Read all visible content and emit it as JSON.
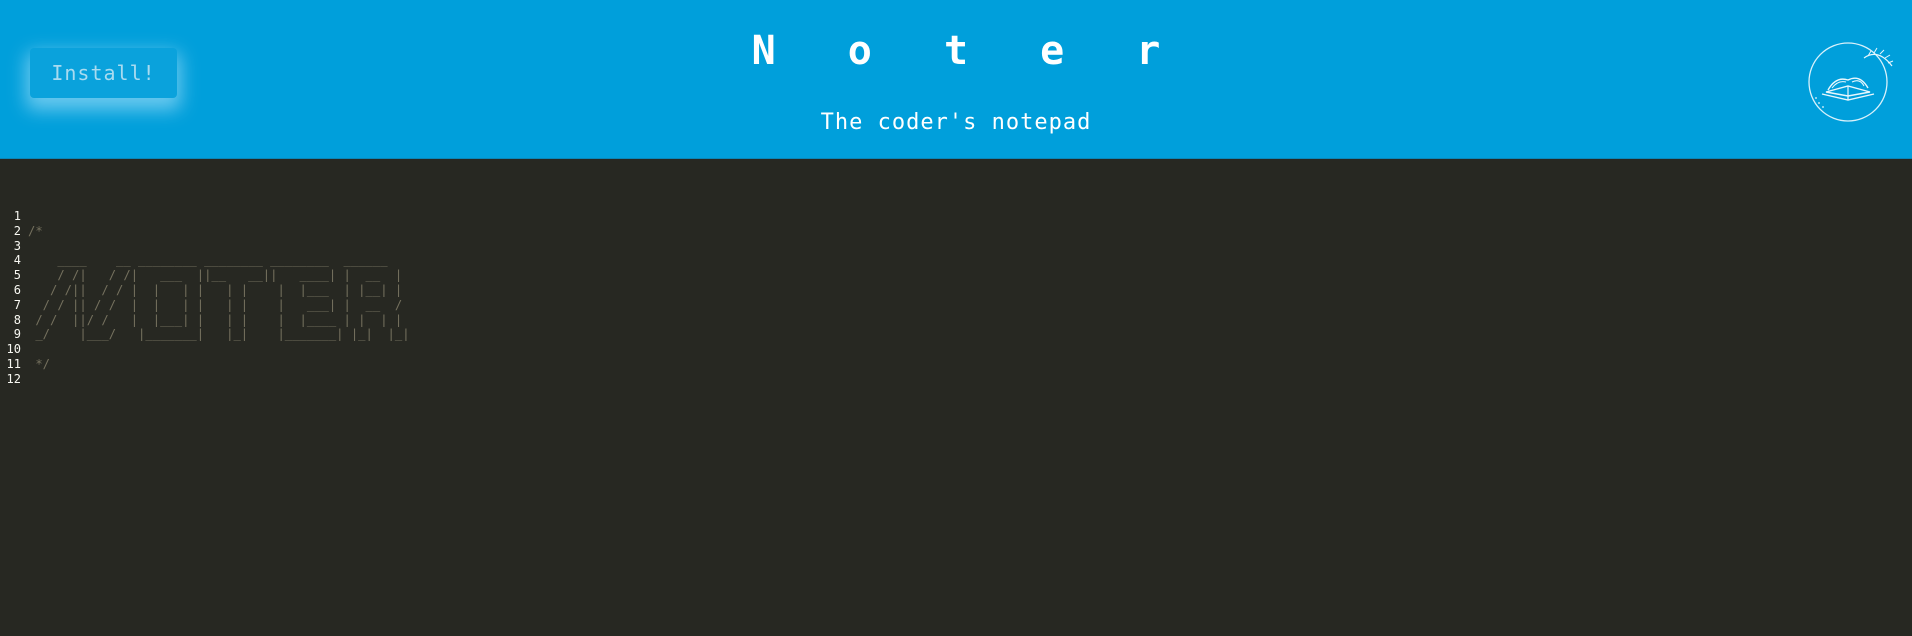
{
  "header": {
    "install_label": "Install!",
    "title": "N o t e r",
    "subtitle": "The coder's notepad",
    "logo_icon": "open-book-icon"
  },
  "editor": {
    "line_numbers": [
      "1",
      "2",
      "3",
      "4",
      "5",
      "6",
      "7",
      "8",
      "9",
      "10",
      "11",
      "12"
    ],
    "lines": [
      "",
      "/*",
      "",
      "    ____    __ ________ ________ ________  ______",
      "    / /|   / /|   ___  ||__   __||   ____| |  __  |",
      "   / /||  / / |  |   | |   | |    |  |___  | |__| |",
      "  / / || / /  |  |   | |   | |    |   ___| |  __  /",
      " / /  ||/ /   |  |___| |   | |    |  |____ | |  | |",
      " _/    |___/   |_______|   |_|    |_______| |_|  |_|",
      "",
      " */",
      ""
    ]
  },
  "colors": {
    "header_bg": "#009fdb",
    "editor_bg": "#272822",
    "comment": "#75715e",
    "gutter_text": "#f8f8f2"
  }
}
